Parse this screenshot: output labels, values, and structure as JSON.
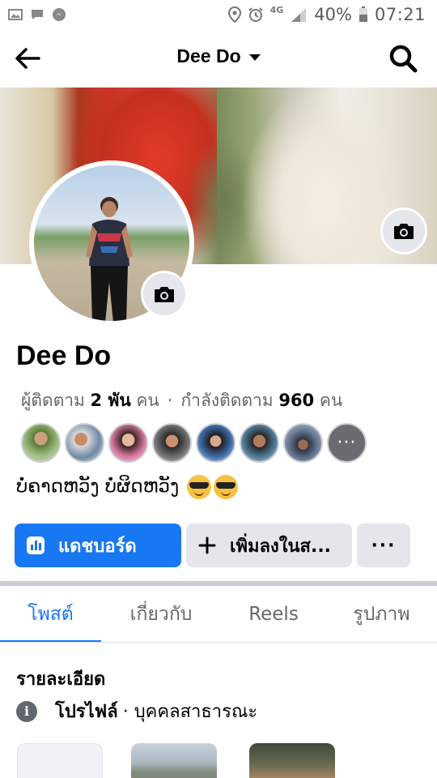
{
  "status_bar": {
    "battery": "40%",
    "time": "07:21",
    "network": "4G"
  },
  "header": {
    "title": "Dee Do"
  },
  "profile": {
    "name": "Dee Do",
    "followers_label": "ผู้ติดตาม",
    "followers_count": "2 พัน",
    "followers_unit": "คน",
    "following_label": "กำลังติดตาม",
    "following_count": "960",
    "following_unit": "คน",
    "separator": "·",
    "bio": "ບໍ່ຄາດຫວັງ ບໍ່ຜິດຫວັງ",
    "more_friends": "···"
  },
  "actions": {
    "dashboard": "แดชบอร์ด",
    "add_story": "เพิ่มลงในส...",
    "more": "···"
  },
  "tabs": [
    {
      "label": "โพสต์",
      "active": true
    },
    {
      "label": "เกี่ยวกับ",
      "active": false
    },
    {
      "label": "Reels",
      "active": false
    },
    {
      "label": "รูปภาพ",
      "active": false
    }
  ],
  "details": {
    "title": "รายละเอียด",
    "profile_label": "โปรไฟล์",
    "profile_type": "· บุคคลสาธารณะ"
  },
  "colors": {
    "accent": "#1877f2",
    "secondary_bg": "#e4e6eb",
    "muted_text": "#65676b"
  }
}
